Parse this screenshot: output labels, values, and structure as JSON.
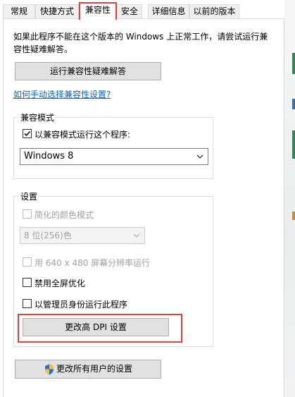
{
  "tabs": [
    {
      "label": "常规"
    },
    {
      "label": "快捷方式"
    },
    {
      "label": "兼容性"
    },
    {
      "label": "安全"
    },
    {
      "label": "详细信息"
    },
    {
      "label": "以前的版本"
    }
  ],
  "active_tab": "兼容性",
  "intro_text_line1": "如果此程序不能在这个版本的 Windows 上正常工作，请尝试运行兼",
  "intro_text_line2": "容性疑难解答。",
  "troubleshooter_button": "运行兼容性疑难解答",
  "manual_link": "如何手动选择兼容性设置?",
  "compat_mode": {
    "title": "兼容模式",
    "checkbox_label": "以兼容模式运行这个程序:",
    "checked": true,
    "selected_os": "Windows 8"
  },
  "settings": {
    "title": "设置",
    "reduced_color": {
      "label": "简化的颜色模式",
      "checked": false,
      "enabled": false
    },
    "color_select": "8 位(256)色",
    "resolution": {
      "label": "用 640 x 480 屏幕分辨率运行",
      "checked": false,
      "enabled": false
    },
    "disable_fullscreen": {
      "label": "禁用全屏优化",
      "checked": false
    },
    "run_as_admin": {
      "label": "以管理员身份运行此程序",
      "checked": false
    },
    "dpi_button": "更改高 DPI 设置"
  },
  "all_users_button": "更改所有用户的设置",
  "colors": {
    "highlight": "#e0403c",
    "link": "#0066cc",
    "button_bg": "#e1e1e1"
  }
}
